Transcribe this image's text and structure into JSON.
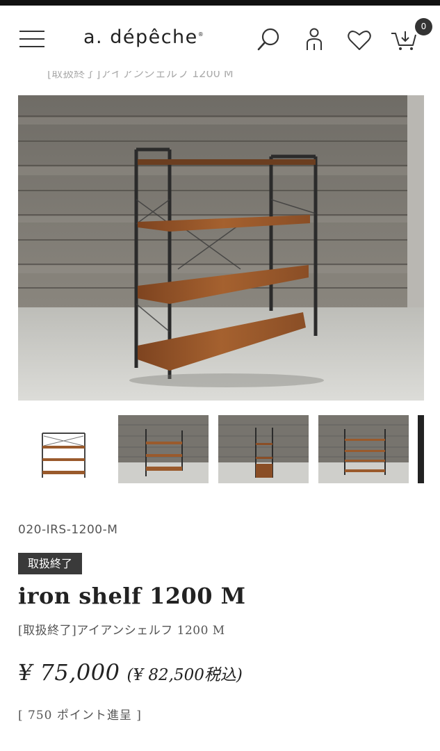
{
  "header": {
    "brand": "a. dépêche",
    "brand_mark": "®",
    "icons": [
      "menu-icon",
      "search-icon",
      "user-icon",
      "heart-icon",
      "cart-icon"
    ],
    "cart_count": "0"
  },
  "breadcrumb_ghost": "[取扱終了]アイアンシェルフ 1200 M",
  "gallery": {
    "main_image": "iron shelf photo against weathered wood wall",
    "thumbnail_count": 5,
    "active_thumbnail": 1
  },
  "product": {
    "sku": "020-IRS-1200-M",
    "status_badge": "取扱終了",
    "title": "iron shelf 1200 M",
    "subtitle": "[取扱終了]アイアンシェルフ 1200 M",
    "price": "¥ 75,000",
    "price_tax_in": "(¥ 82,500税込)",
    "points": "[ 750 ポイント進呈 ]"
  },
  "colors": {
    "text": "#222222",
    "badge_bg": "#3a3a3a",
    "wood": "#9a5a2c",
    "wall": "#8d8a84",
    "floor": "#cfcfcb"
  }
}
